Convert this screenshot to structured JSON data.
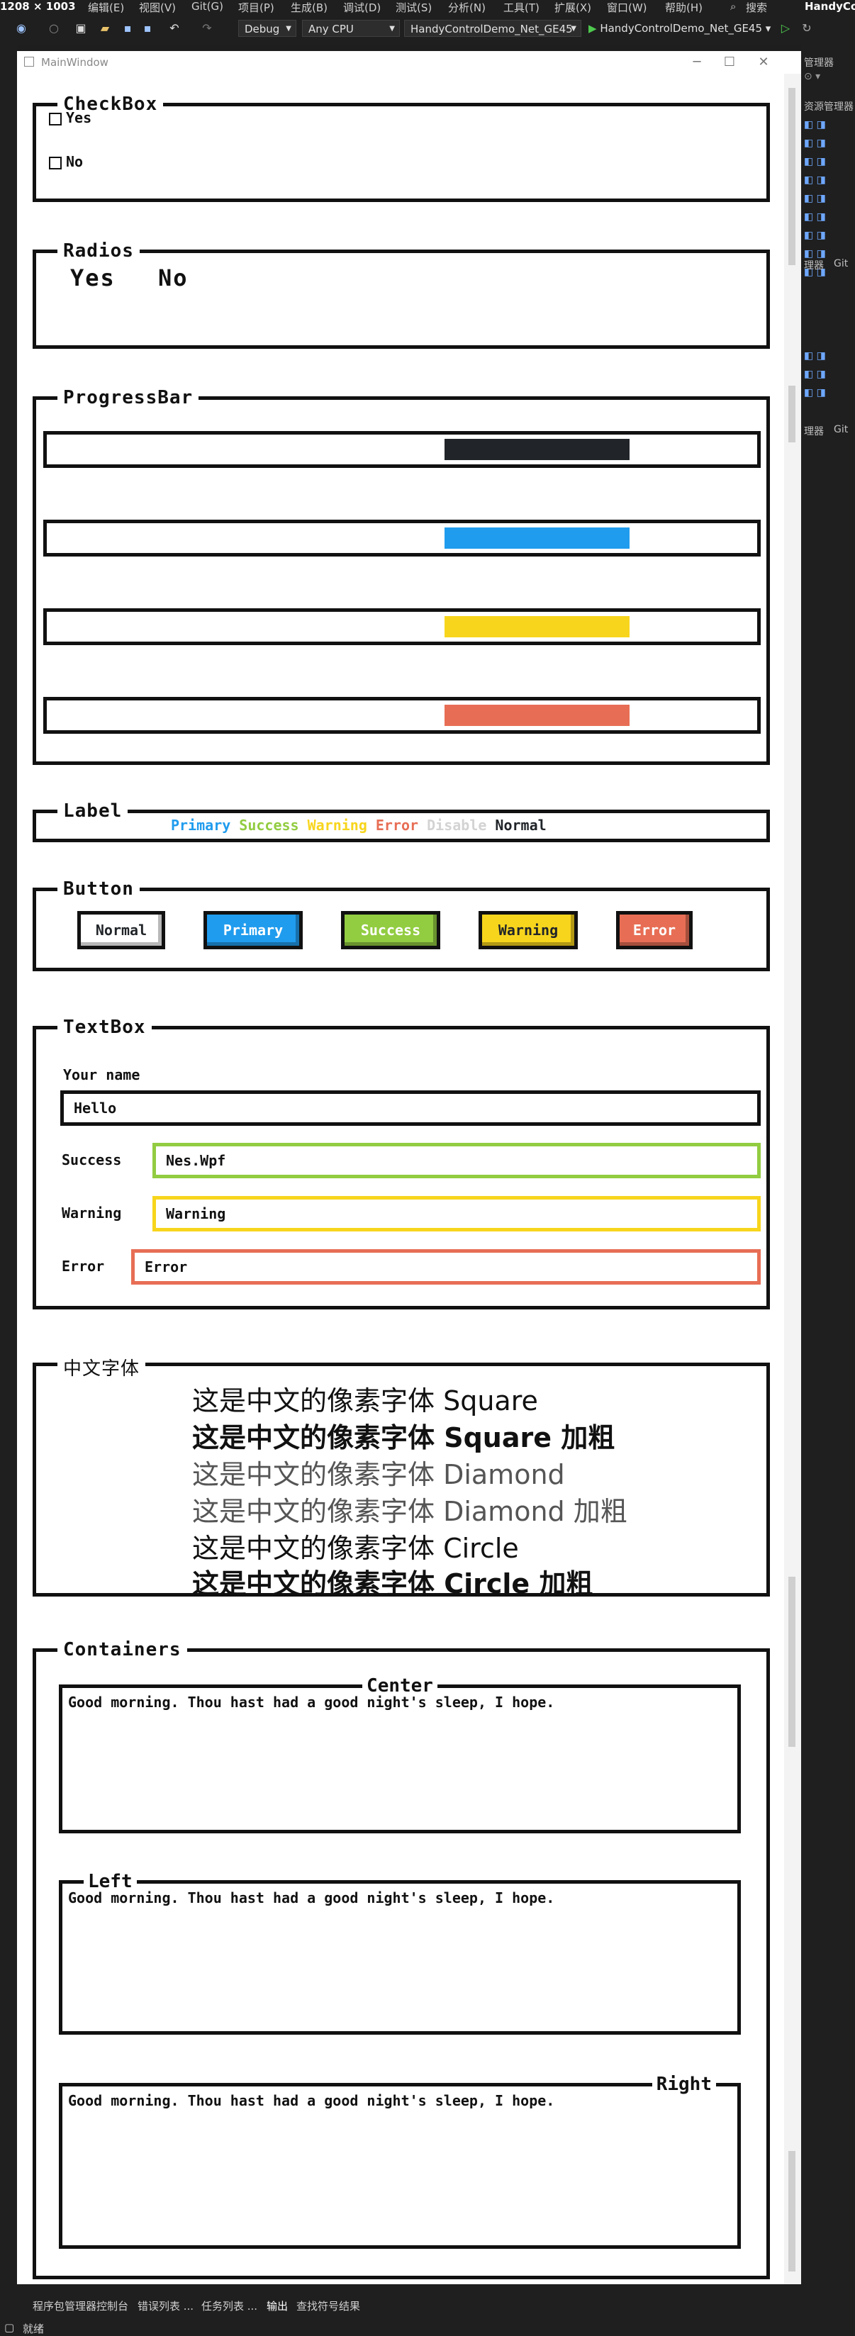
{
  "ide": {
    "menu": [
      "编辑(E)",
      "视图(V)",
      "Git(G)",
      "项目(P)",
      "生成(B)",
      "调试(D)",
      "测试(S)",
      "分析(N)",
      "工具(T)",
      "扩展(X)",
      "窗口(W)",
      "帮助(H)"
    ],
    "resolution": "1208 × 1003",
    "search": "搜索",
    "app_name": "HandyCo",
    "config": "Debug",
    "platform": "Any CPU",
    "project": "HandyControlDemo_Net_GE45",
    "run_target": "HandyControlDemo_Net_GE45",
    "right_panel": {
      "top": "管理器",
      "explorer": "资源管理器",
      "middle1": "理器",
      "git": "Git",
      "middle2": "理器",
      "git2": "Git"
    },
    "bottom_tabs": [
      "程序包管理器控制台",
      "错误列表 ...",
      "任务列表 ...",
      "输出",
      "查找符号结果"
    ],
    "status": "就绪"
  },
  "window": {
    "title": "MainWindow"
  },
  "checkbox": {
    "legend": "CheckBox",
    "items": [
      "Yes",
      "No"
    ]
  },
  "radios": {
    "legend": "Radios",
    "items": [
      "Yes",
      "No"
    ]
  },
  "progress": {
    "legend": "ProgressBar",
    "bars": [
      {
        "color": "#212529",
        "value": 0.82
      },
      {
        "color": "#209cee",
        "value": 0.82
      },
      {
        "color": "#f7d51d",
        "value": 0.82
      },
      {
        "color": "#e76e55",
        "value": 0.82
      }
    ]
  },
  "label": {
    "legend": "Label",
    "items": [
      {
        "text": "Primary",
        "color": "#209cee"
      },
      {
        "text": "Success",
        "color": "#92cc41"
      },
      {
        "text": "Warning",
        "color": "#f7d51d"
      },
      {
        "text": "Error",
        "color": "#e76e55"
      },
      {
        "text": "Disable",
        "color": "#d3d3d3"
      },
      {
        "text": "Normal",
        "color": "#212529"
      }
    ]
  },
  "button": {
    "legend": "Button",
    "items": [
      {
        "text": "Normal",
        "bg": "#ffffff",
        "fg": "#212529"
      },
      {
        "text": "Primary",
        "bg": "#209cee",
        "fg": "#ffffff"
      },
      {
        "text": "Success",
        "bg": "#92cc41",
        "fg": "#ffffff"
      },
      {
        "text": "Warning",
        "bg": "#f7d51d",
        "fg": "#212529"
      },
      {
        "text": "Error",
        "bg": "#e76e55",
        "fg": "#ffffff"
      }
    ]
  },
  "textbox": {
    "legend": "TextBox",
    "name_label": "Your name",
    "name_value": "Hello",
    "success_label": "Success",
    "success_value": "Nes.Wpf",
    "warning_label": "Warning",
    "warning_value": "Warning",
    "error_label": "Error",
    "error_value": "Error",
    "colors": {
      "success": "#92cc41",
      "warning": "#f7d51d",
      "error": "#e76e55"
    }
  },
  "chinese": {
    "legend": "中文字体",
    "lines": [
      "这是中文的像素字体 Square",
      "这是中文的像素字体 Square 加粗",
      "这是中文的像素字体 Diamond",
      "这是中文的像素字体 Diamond 加粗",
      "这是中文的像素字体 Circle",
      "这是中文的像素字体 Circle 加粗"
    ]
  },
  "containers": {
    "legend": "Containers",
    "boxes": [
      {
        "title": "Center",
        "text": "Good morning. Thou hast had a good night's sleep, I hope."
      },
      {
        "title": "Left",
        "text": "Good morning. Thou hast had a good night's sleep, I hope."
      },
      {
        "title": "Right",
        "text": "Good morning. Thou hast had a good night's sleep, I hope."
      }
    ]
  }
}
